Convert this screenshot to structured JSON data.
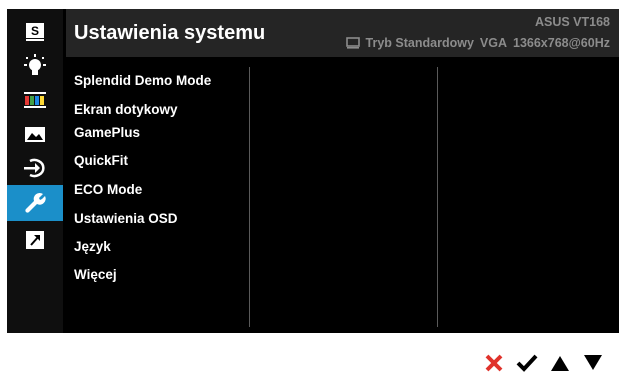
{
  "header": {
    "title": "Ustawienia systemu",
    "model": "ASUS VT168",
    "mode": "Tryb Standardowy",
    "input": "VGA",
    "resolution": "1366x768@60Hz"
  },
  "sidebar": {
    "active_index": 5,
    "items": [
      {
        "icon": "splendid-s-icon"
      },
      {
        "icon": "brightness-bulb-icon"
      },
      {
        "icon": "color-bars-icon"
      },
      {
        "icon": "image-landscape-icon"
      },
      {
        "icon": "input-select-icon"
      },
      {
        "icon": "wrench-icon"
      },
      {
        "icon": "shortcut-arrow-icon"
      }
    ]
  },
  "menu": {
    "items": [
      "Splendid Demo Mode",
      "Ekran dotykowy",
      "GamePlus",
      "QuickFit",
      "ECO Mode",
      "Ustawienia OSD",
      "Język",
      "Więcej"
    ]
  },
  "nav": {
    "buttons": [
      {
        "name": "close-icon",
        "color": "#e0322b"
      },
      {
        "name": "check-icon",
        "color": "#000000"
      },
      {
        "name": "up-triangle-icon",
        "color": "#000000"
      },
      {
        "name": "down-triangle-icon",
        "color": "#000000"
      }
    ]
  },
  "colors": {
    "accent": "#1b8fc9",
    "header_bg": "#252525",
    "panel_bg": "#000000",
    "muted_text": "#8c8c8c"
  }
}
